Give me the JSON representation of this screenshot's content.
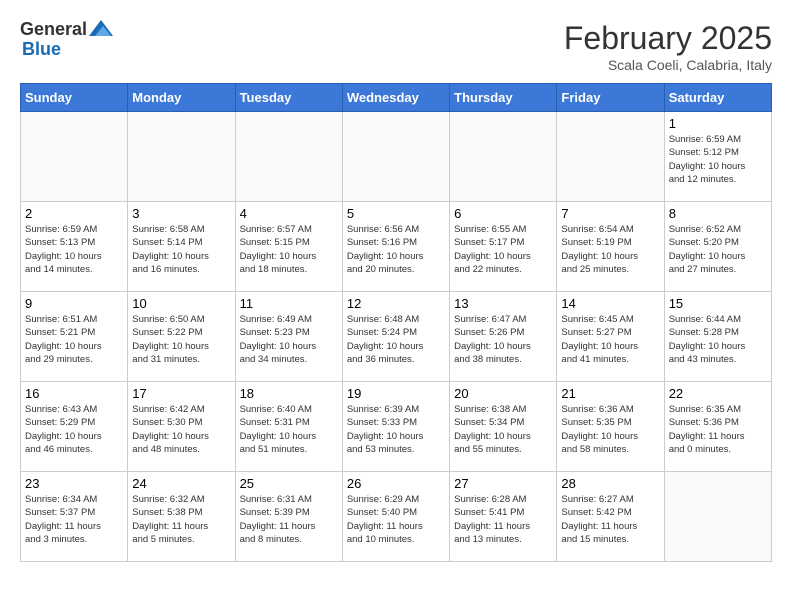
{
  "header": {
    "logo_general": "General",
    "logo_blue": "Blue",
    "month_title": "February 2025",
    "subtitle": "Scala Coeli, Calabria, Italy"
  },
  "calendar": {
    "days_of_week": [
      "Sunday",
      "Monday",
      "Tuesday",
      "Wednesday",
      "Thursday",
      "Friday",
      "Saturday"
    ],
    "weeks": [
      [
        {
          "day": "",
          "info": ""
        },
        {
          "day": "",
          "info": ""
        },
        {
          "day": "",
          "info": ""
        },
        {
          "day": "",
          "info": ""
        },
        {
          "day": "",
          "info": ""
        },
        {
          "day": "",
          "info": ""
        },
        {
          "day": "1",
          "info": "Sunrise: 6:59 AM\nSunset: 5:12 PM\nDaylight: 10 hours\nand 12 minutes."
        }
      ],
      [
        {
          "day": "2",
          "info": "Sunrise: 6:59 AM\nSunset: 5:13 PM\nDaylight: 10 hours\nand 14 minutes."
        },
        {
          "day": "3",
          "info": "Sunrise: 6:58 AM\nSunset: 5:14 PM\nDaylight: 10 hours\nand 16 minutes."
        },
        {
          "day": "4",
          "info": "Sunrise: 6:57 AM\nSunset: 5:15 PM\nDaylight: 10 hours\nand 18 minutes."
        },
        {
          "day": "5",
          "info": "Sunrise: 6:56 AM\nSunset: 5:16 PM\nDaylight: 10 hours\nand 20 minutes."
        },
        {
          "day": "6",
          "info": "Sunrise: 6:55 AM\nSunset: 5:17 PM\nDaylight: 10 hours\nand 22 minutes."
        },
        {
          "day": "7",
          "info": "Sunrise: 6:54 AM\nSunset: 5:19 PM\nDaylight: 10 hours\nand 25 minutes."
        },
        {
          "day": "8",
          "info": "Sunrise: 6:52 AM\nSunset: 5:20 PM\nDaylight: 10 hours\nand 27 minutes."
        }
      ],
      [
        {
          "day": "9",
          "info": "Sunrise: 6:51 AM\nSunset: 5:21 PM\nDaylight: 10 hours\nand 29 minutes."
        },
        {
          "day": "10",
          "info": "Sunrise: 6:50 AM\nSunset: 5:22 PM\nDaylight: 10 hours\nand 31 minutes."
        },
        {
          "day": "11",
          "info": "Sunrise: 6:49 AM\nSunset: 5:23 PM\nDaylight: 10 hours\nand 34 minutes."
        },
        {
          "day": "12",
          "info": "Sunrise: 6:48 AM\nSunset: 5:24 PM\nDaylight: 10 hours\nand 36 minutes."
        },
        {
          "day": "13",
          "info": "Sunrise: 6:47 AM\nSunset: 5:26 PM\nDaylight: 10 hours\nand 38 minutes."
        },
        {
          "day": "14",
          "info": "Sunrise: 6:45 AM\nSunset: 5:27 PM\nDaylight: 10 hours\nand 41 minutes."
        },
        {
          "day": "15",
          "info": "Sunrise: 6:44 AM\nSunset: 5:28 PM\nDaylight: 10 hours\nand 43 minutes."
        }
      ],
      [
        {
          "day": "16",
          "info": "Sunrise: 6:43 AM\nSunset: 5:29 PM\nDaylight: 10 hours\nand 46 minutes."
        },
        {
          "day": "17",
          "info": "Sunrise: 6:42 AM\nSunset: 5:30 PM\nDaylight: 10 hours\nand 48 minutes."
        },
        {
          "day": "18",
          "info": "Sunrise: 6:40 AM\nSunset: 5:31 PM\nDaylight: 10 hours\nand 51 minutes."
        },
        {
          "day": "19",
          "info": "Sunrise: 6:39 AM\nSunset: 5:33 PM\nDaylight: 10 hours\nand 53 minutes."
        },
        {
          "day": "20",
          "info": "Sunrise: 6:38 AM\nSunset: 5:34 PM\nDaylight: 10 hours\nand 55 minutes."
        },
        {
          "day": "21",
          "info": "Sunrise: 6:36 AM\nSunset: 5:35 PM\nDaylight: 10 hours\nand 58 minutes."
        },
        {
          "day": "22",
          "info": "Sunrise: 6:35 AM\nSunset: 5:36 PM\nDaylight: 11 hours\nand 0 minutes."
        }
      ],
      [
        {
          "day": "23",
          "info": "Sunrise: 6:34 AM\nSunset: 5:37 PM\nDaylight: 11 hours\nand 3 minutes."
        },
        {
          "day": "24",
          "info": "Sunrise: 6:32 AM\nSunset: 5:38 PM\nDaylight: 11 hours\nand 5 minutes."
        },
        {
          "day": "25",
          "info": "Sunrise: 6:31 AM\nSunset: 5:39 PM\nDaylight: 11 hours\nand 8 minutes."
        },
        {
          "day": "26",
          "info": "Sunrise: 6:29 AM\nSunset: 5:40 PM\nDaylight: 11 hours\nand 10 minutes."
        },
        {
          "day": "27",
          "info": "Sunrise: 6:28 AM\nSunset: 5:41 PM\nDaylight: 11 hours\nand 13 minutes."
        },
        {
          "day": "28",
          "info": "Sunrise: 6:27 AM\nSunset: 5:42 PM\nDaylight: 11 hours\nand 15 minutes."
        },
        {
          "day": "",
          "info": ""
        }
      ]
    ]
  }
}
